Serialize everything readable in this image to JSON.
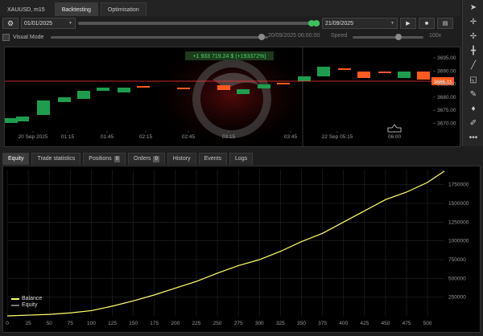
{
  "tabs": [
    {
      "label": "XAUUSD, m15",
      "active": false
    },
    {
      "label": "Backtesting",
      "active": true
    },
    {
      "label": "Optimisation",
      "active": false
    }
  ],
  "controls": {
    "start_date": "01/01/2025",
    "end_date": "21/09/2025",
    "range_start_fraction": 0.98,
    "range_end_fraction": 1.0
  },
  "visual_mode": {
    "label": "Visual Mode",
    "checked": false,
    "timestamp": "20/09/2025 06:00:00",
    "speed_label": "Speed",
    "speed_value": "100x"
  },
  "price_chart": {
    "profit_label": "+1 933 719.24 $ (+193372%)",
    "current_price": "3686.11",
    "price_ticks": [
      "3695.00",
      "3690.00",
      "3685.00",
      "3680.00",
      "3675.00",
      "3670.00"
    ],
    "time_ticks": [
      "20 Sep 2025",
      "01:15",
      "01:45",
      "02:15",
      "02:45",
      "03:15",
      "03:45",
      "22 Sep 05:15",
      "06:00"
    ],
    "colors": {
      "bull": "#1f9d4f",
      "bear": "#ff5a1f",
      "price_line": "#ff3333",
      "profit_bg": "#1c3a1c",
      "profit_text": "#4cd964"
    }
  },
  "bottom_tabs": [
    {
      "label": "Equity",
      "active": true,
      "badge": null
    },
    {
      "label": "Trade statistics",
      "active": false,
      "badge": null
    },
    {
      "label": "Positions",
      "active": false,
      "badge": "0"
    },
    {
      "label": "Orders",
      "active": false,
      "badge": "0"
    },
    {
      "label": "History",
      "active": false,
      "badge": null
    },
    {
      "label": "Events",
      "active": false,
      "badge": null
    },
    {
      "label": "Logs",
      "active": false,
      "badge": null
    }
  ],
  "right_toolbar": [
    "cursor-icon",
    "crosshair-icon",
    "cross-icon",
    "plus-icon",
    "trendline-icon",
    "shapes-icon",
    "ruler-icon",
    "brush-icon",
    "pen-icon",
    "more-icon"
  ],
  "chart_data": {
    "type": "line",
    "x_ticks": [
      "0",
      "25",
      "50",
      "75",
      "100",
      "125",
      "150",
      "175",
      "200",
      "225",
      "250",
      "275",
      "300",
      "325",
      "350",
      "375",
      "400",
      "425",
      "450",
      "475",
      "500"
    ],
    "y_ticks": [
      "1750000",
      "1500000",
      "1250000",
      "1000000",
      "750000",
      "500000",
      "250000"
    ],
    "xlim": [
      0,
      520
    ],
    "ylim": [
      0,
      1950000
    ],
    "series": [
      {
        "name": "Balance",
        "color": "#ffff66",
        "x": [
          0,
          25,
          50,
          75,
          100,
          125,
          150,
          175,
          200,
          225,
          250,
          275,
          300,
          325,
          350,
          375,
          400,
          425,
          450,
          475,
          500,
          520
        ],
        "values": [
          0,
          10000,
          20000,
          40000,
          70000,
          130000,
          200000,
          280000,
          370000,
          460000,
          570000,
          670000,
          750000,
          860000,
          990000,
          1100000,
          1250000,
          1400000,
          1550000,
          1650000,
          1780000,
          1930000
        ]
      },
      {
        "name": "Equity",
        "color": "#7a7a7a",
        "x": [
          0,
          25,
          50,
          75,
          100,
          125,
          150,
          175,
          200,
          225,
          250,
          275,
          300,
          325,
          350,
          375,
          400,
          425,
          450,
          475,
          500,
          520
        ],
        "values": [
          0,
          10000,
          20000,
          40000,
          70000,
          130000,
          200000,
          280000,
          370000,
          460000,
          570000,
          670000,
          750000,
          860000,
          990000,
          1100000,
          1250000,
          1400000,
          1550000,
          1650000,
          1780000,
          1930000
        ]
      }
    ],
    "grid": true,
    "legend": "bottom-left"
  }
}
